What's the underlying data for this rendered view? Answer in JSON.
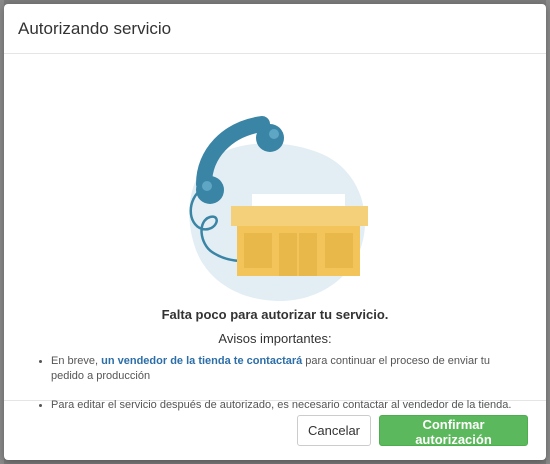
{
  "dialog": {
    "title": "Autorizando servicio",
    "headline": "Falta poco para autorizar tu servicio.",
    "subhead": "Avisos importantes:",
    "notes": [
      {
        "before": "En breve, ",
        "highlight": "un vendedor de la tienda te contactará",
        "after": " para continuar el proceso de enviar tu pedido a producción"
      },
      {
        "text": "Para editar el servicio después de autorizado, es necesario contactar al vendedor de la tienda."
      }
    ],
    "buttons": {
      "cancel": "Cancelar",
      "confirm": "Confirmar autorización"
    }
  },
  "illustration": {
    "icons": [
      "phone-handset-icon",
      "storefront-icon"
    ],
    "colors": {
      "blob": "#e3eef4",
      "phone": "#3a84a5",
      "store": "#f2c45a",
      "awning": "#f5d07a"
    }
  },
  "colors": {
    "confirm": "#5cb85c",
    "link": "#2c6ea8",
    "backdrop": "#7b7b7b"
  }
}
